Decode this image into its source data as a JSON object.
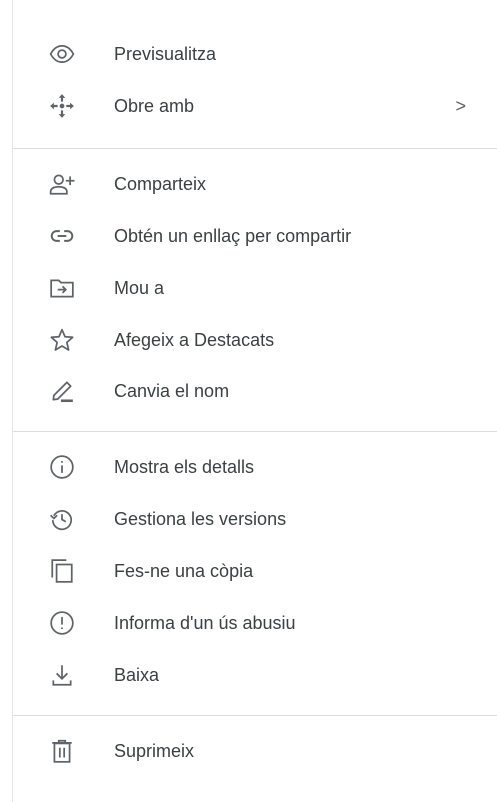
{
  "menu": {
    "items": [
      {
        "label": "Previsualitza",
        "icon": "eye-icon"
      },
      {
        "label": "Obre amb",
        "icon": "move-arrows-icon",
        "chevron": ">"
      },
      {
        "label": "Comparteix",
        "icon": "person-add-icon"
      },
      {
        "label": "Obtén un enllaç per compartir",
        "icon": "link-icon"
      },
      {
        "label": "Mou a",
        "icon": "move-to-folder-icon"
      },
      {
        "label": "Afegeix a Destacats",
        "icon": "star-icon"
      },
      {
        "label": "Canvia el nom",
        "icon": "pencil-icon"
      },
      {
        "label": "Mostra els detalls",
        "icon": "info-icon"
      },
      {
        "label": "Gestiona les versions",
        "icon": "history-icon"
      },
      {
        "label": "Fes-ne una còpia",
        "icon": "copy-icon"
      },
      {
        "label": "Informa d'un ús abusiu",
        "icon": "report-icon"
      },
      {
        "label": "Baixa",
        "icon": "download-icon"
      },
      {
        "label": "Suprimeix",
        "icon": "trash-icon"
      }
    ]
  },
  "colors": {
    "icon": "#5f6368",
    "text": "#3c4043",
    "divider": "#dadce0"
  }
}
